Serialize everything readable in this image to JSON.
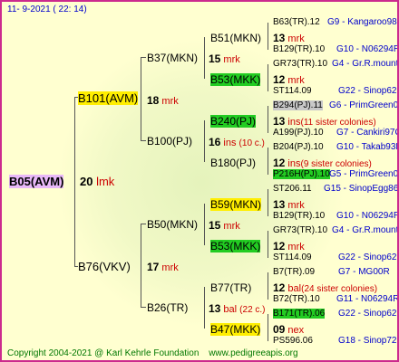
{
  "date": "11-  9-2021 (  22:  14)",
  "copyright": "Copyright 2004-2021 @ Karl Kehrle Foundation",
  "site": "www.pedigreeapis.org",
  "root": {
    "name": "B05(AVM)",
    "num": "20",
    "note": "lmk"
  },
  "g1": [
    {
      "name": "B101(AVM)",
      "num": "18",
      "note": "mrk"
    },
    {
      "name": "B76(VKV)",
      "num": "17",
      "note": "mrk"
    }
  ],
  "g2": [
    {
      "name": "B37(MKN)",
      "num": "15",
      "note": "mrk"
    },
    {
      "name": "B100(PJ)",
      "num": "16",
      "note": "ins",
      "extra": "(10 c.)"
    },
    {
      "name": "B50(MKN)",
      "num": "15",
      "note": "mrk"
    },
    {
      "name": "B26(TR)",
      "num": "13",
      "note": "bal",
      "extra": "(22 c.)"
    }
  ],
  "g3": [
    {
      "name": "B51(MKN)",
      "num": "13",
      "note": "mrk"
    },
    {
      "name": "B53(MKK)",
      "num": "12",
      "note": "mrk"
    },
    {
      "name": "B240(PJ)",
      "num": "13",
      "note": "ins",
      "extra": "(11 sister colonies)"
    },
    {
      "name": "B180(PJ)",
      "num": "12",
      "note": "ins",
      "extra": "(9 sister colonies)"
    },
    {
      "name": "B59(MKN)",
      "num": "13",
      "note": "mrk"
    },
    {
      "name": "B53(MKK)",
      "num": "12",
      "note": "mrk"
    },
    {
      "name": "B77(TR)",
      "num": "12",
      "note": "bal",
      "extra": "(24 sister colonies)"
    },
    {
      "name": "B47(MKK)",
      "num": "09",
      "note": "nex"
    }
  ],
  "g4": [
    {
      "name": "B63(TR).12",
      "right": "G9 - Kangaroo98R"
    },
    {
      "name": "B129(TR).10",
      "right": "G10 - N06294R"
    },
    {
      "name": "GR73(TR).10",
      "right": "G4 - Gr.R.mounta"
    },
    {
      "name": "ST114.09",
      "right": "G22 - Sinop62R"
    },
    {
      "name": "B294(PJ).11",
      "right": "G6 - PrimGreen00"
    },
    {
      "name": "A199(PJ).10",
      "right": "G7 - Cankiri97Q"
    },
    {
      "name": "B204(PJ).10",
      "right": "G10 - Takab93R"
    },
    {
      "name": "P216H(PJ).10",
      "right": "G5 - PrimGreen00"
    },
    {
      "name": "ST206.11",
      "right": "G15 - SinopEgg86R"
    },
    {
      "name": "B129(TR).10",
      "right": "G10 - N06294R"
    },
    {
      "name": "GR73(TR).10",
      "right": "G4 - Gr.R.mounta"
    },
    {
      "name": "ST114.09",
      "right": "G22 - Sinop62R"
    },
    {
      "name": "B7(TR).09",
      "right": "G7 - MG00R"
    },
    {
      "name": "B72(TR).10",
      "right": "G11 - N06294R"
    },
    {
      "name": "B171(TR).06",
      "right": "G22 - Sinop62R"
    },
    {
      "name": "PS596.06",
      "right": "G18 - Sinop72R"
    }
  ]
}
